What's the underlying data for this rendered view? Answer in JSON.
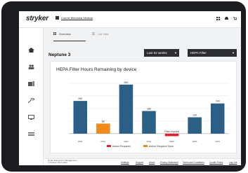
{
  "header": {
    "logo": "stryker",
    "facility": "Connie Memorial Medical",
    "icons": [
      "grid-icon",
      "print-icon",
      "cart-icon"
    ]
  },
  "sidebar": {
    "icons": [
      "home-icon",
      "users-icon",
      "devices-icon",
      "tools-icon",
      "monitor-icon",
      "list-icon"
    ]
  },
  "tabs": [
    {
      "label": "Overview",
      "icon": "grid-icon",
      "active": true
    },
    {
      "label": "List View",
      "icon": "list-icon",
      "active": false
    }
  ],
  "device": {
    "name": "Neptune 3"
  },
  "filters": {
    "period": "Last 52 weeks",
    "metric": "HEPA Filter"
  },
  "chart_data": {
    "type": "bar",
    "title": "HEPA Filter Hours Remaining by device",
    "ylim": [
      -40,
      450
    ],
    "categories": [
      "0001",
      "0002",
      "0003",
      "0004",
      "0005",
      "0006",
      "0007"
    ],
    "values": [
      260,
      80,
      390,
      180,
      -20,
      130,
      240
    ],
    "labels": [
      "260",
      "80",
      "390",
      "180",
      "Filter expired",
      "130",
      "240"
    ],
    "status": [
      "ok",
      "soon",
      "ok",
      "ok",
      "required",
      "ok",
      "ok"
    ],
    "colors": {
      "ok": "#2b5f86",
      "soon": "#f08a1c",
      "required": "#e0202a"
    },
    "legend": [
      {
        "label": "Action Required",
        "status": "required"
      },
      {
        "label": "Action Required Soon",
        "status": "soon"
      }
    ],
    "grid": true
  },
  "footer": {
    "brand_line1": "Smart Equipment Management",
    "brand_line2": "© Stryker 2017-2024",
    "links": [
      "Settings",
      "Support",
      "About",
      "Privacy Statement",
      "Terms and Conditions",
      "Cookie Policy",
      "Log Out"
    ]
  }
}
